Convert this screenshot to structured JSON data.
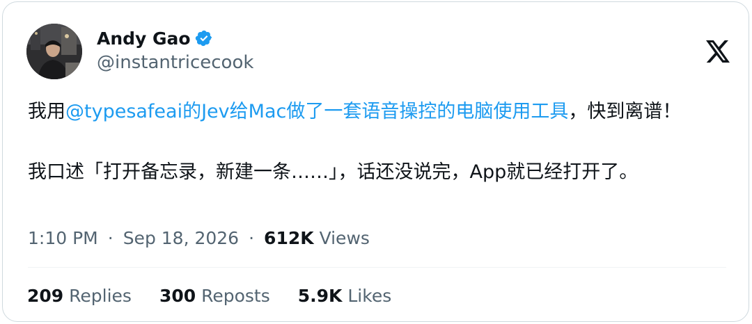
{
  "author": {
    "display_name": "Andy Gao",
    "handle": "@instantricecook",
    "verified": true
  },
  "tweet": {
    "line1_prefix": "我用",
    "mention": "@typesafeai的Jev给Mac做了一套语音操控的电脑使用工具",
    "line1_suffix": "，快到离谱！",
    "paragraph2": "我口述「打开备忘录，新建一条……」，话还没说完，App就已经打开了。"
  },
  "meta": {
    "time": "1:10 PM",
    "separator": "·",
    "date": "Sep 18, 2026",
    "views_count": "612K",
    "views_label": "Views"
  },
  "stats": {
    "replies_count": "209",
    "replies_label": "Replies",
    "reposts_count": "300",
    "reposts_label": "Reposts",
    "likes_count": "5.9K",
    "likes_label": "Likes"
  },
  "colors": {
    "link": "#1d9bf0",
    "verified_badge": "#1d9bf0",
    "secondary_text": "#536471",
    "primary_text": "#0f1419",
    "border": "#cfd9de"
  },
  "icons": {
    "platform_logo": "x-logo-icon",
    "verified": "verified-badge-icon"
  }
}
